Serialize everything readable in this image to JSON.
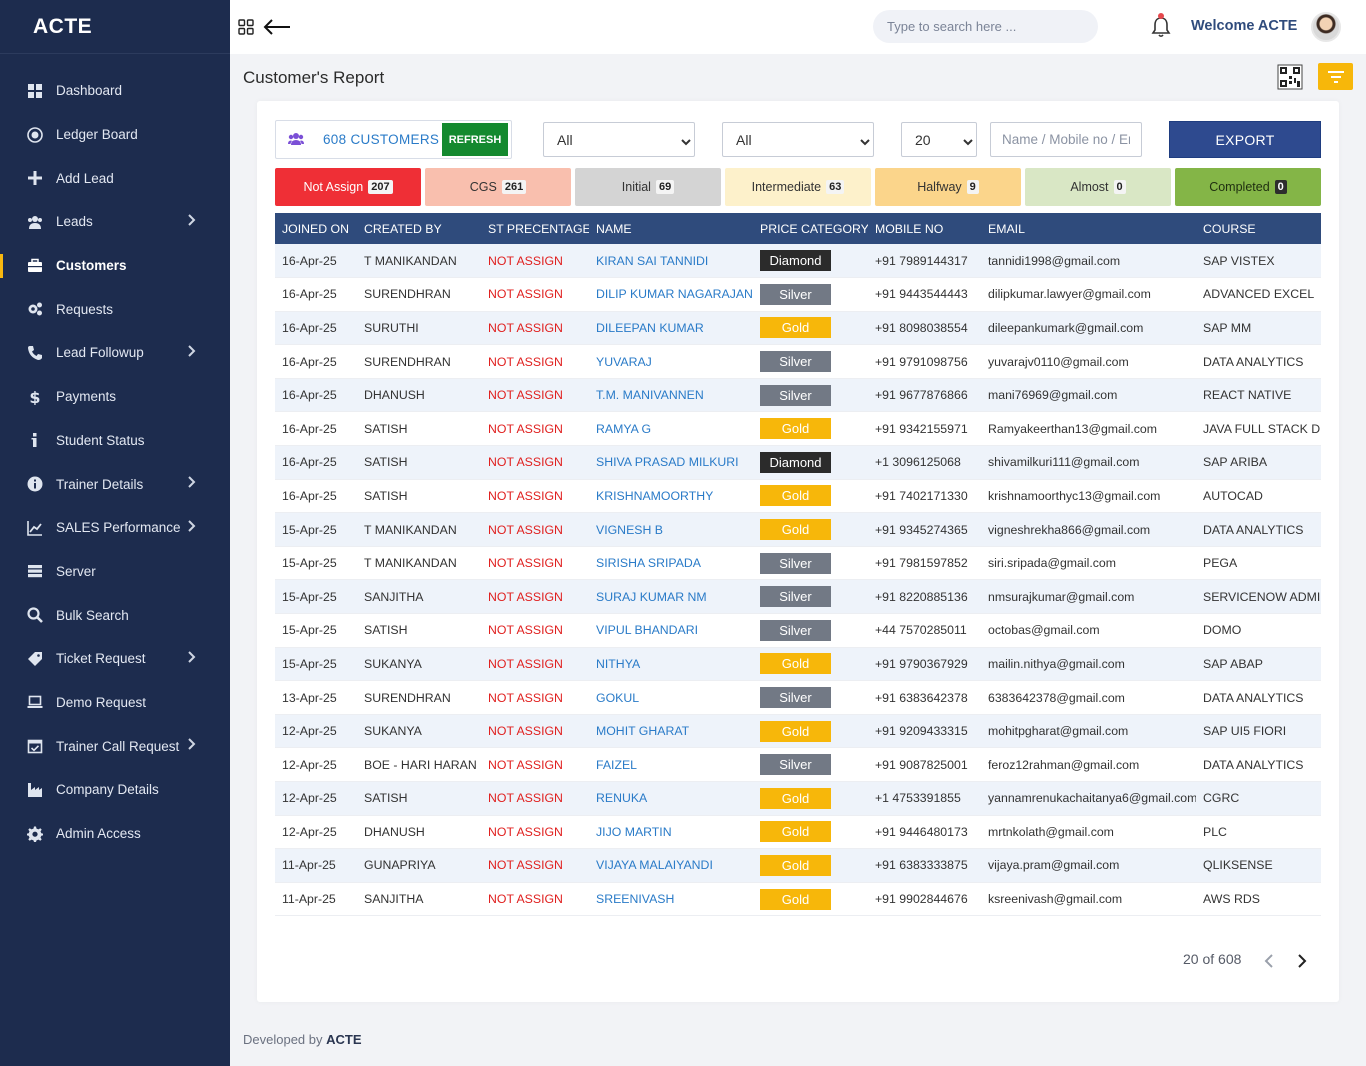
{
  "brand": "ACTE",
  "sidebar": {
    "items": [
      {
        "label": "Dashboard",
        "icon": "dashboard-icon",
        "chevron": false,
        "active": false
      },
      {
        "label": "Ledger Board",
        "icon": "target-icon",
        "chevron": false,
        "active": false
      },
      {
        "label": "Add Lead",
        "icon": "plus-icon",
        "chevron": false,
        "active": false
      },
      {
        "label": "Leads",
        "icon": "users-icon",
        "chevron": true,
        "active": false
      },
      {
        "label": "Customers",
        "icon": "briefcase-icon",
        "chevron": false,
        "active": true
      },
      {
        "label": "Requests",
        "icon": "gears-icon",
        "chevron": false,
        "active": false
      },
      {
        "label": "Lead Followup",
        "icon": "phone-icon",
        "chevron": true,
        "active": false
      },
      {
        "label": "Payments",
        "icon": "dollar-icon",
        "chevron": false,
        "active": false
      },
      {
        "label": "Student Status",
        "icon": "info-icon",
        "chevron": false,
        "active": false
      },
      {
        "label": "Trainer Details",
        "icon": "info-circle-icon",
        "chevron": true,
        "active": false
      },
      {
        "label": "SALES Performance",
        "icon": "chart-line-icon",
        "chevron": true,
        "active": false
      },
      {
        "label": "Server",
        "icon": "server-icon",
        "chevron": false,
        "active": false
      },
      {
        "label": "Bulk Search",
        "icon": "search-icon",
        "chevron": false,
        "active": false
      },
      {
        "label": "Ticket Request",
        "icon": "tag-icon",
        "chevron": true,
        "active": false
      },
      {
        "label": "Demo Request",
        "icon": "laptop-icon",
        "chevron": false,
        "active": false
      },
      {
        "label": "Trainer Call Request",
        "icon": "calendar-check-icon",
        "chevron": true,
        "active": false
      },
      {
        "label": "Company Details",
        "icon": "industry-icon",
        "chevron": false,
        "active": false
      },
      {
        "label": "Admin Access",
        "icon": "gear-icon",
        "chevron": false,
        "active": false
      }
    ]
  },
  "header": {
    "search_placeholder": "Type to search here ...",
    "welcome": "Welcome ACTE"
  },
  "page": {
    "title": "Customer's Report"
  },
  "toolbar": {
    "customers_count": "608 CUSTOMERS",
    "refresh_label": "REFRESH",
    "filter1_value": "All",
    "filter2_value": "All",
    "page_size_value": "20",
    "name_placeholder": "Name / Mobile no / Email",
    "export_label": "EXPORT"
  },
  "statuses": [
    {
      "label": "Not Assign",
      "count": "207",
      "bg": "#ef2f36",
      "fg": "#ffffff",
      "dark_badge": false
    },
    {
      "label": "CGS",
      "count": "261",
      "bg": "#f9bfae",
      "fg": "#333333",
      "dark_badge": false
    },
    {
      "label": "Initial",
      "count": "69",
      "bg": "#d4d4d4",
      "fg": "#333333",
      "dark_badge": false
    },
    {
      "label": "Intermediate",
      "count": "63",
      "bg": "#fdf1cb",
      "fg": "#333333",
      "dark_badge": false
    },
    {
      "label": "Halfway",
      "count": "9",
      "bg": "#fbd58b",
      "fg": "#333333",
      "dark_badge": false
    },
    {
      "label": "Almost",
      "count": "0",
      "bg": "#d9e7c5",
      "fg": "#333333",
      "dark_badge": false
    },
    {
      "label": "Completed",
      "count": "0",
      "bg": "#84b547",
      "fg": "#1f2f10",
      "dark_badge": true
    }
  ],
  "table": {
    "columns": [
      "JOINED ON",
      "CREATED BY",
      "ST PRECENTAGE",
      "NAME",
      "PRICE CATEGORY",
      "MOBILE NO",
      "EMAIL",
      "COURSE"
    ],
    "rows": [
      [
        "16-Apr-25",
        "T MANIKANDAN",
        "NOT ASSIGN",
        "KIRAN SAI TANNIDI",
        "Diamond",
        "+91 7989144317",
        "tannidi1998@gmail.com",
        "SAP VISTEX"
      ],
      [
        "16-Apr-25",
        "SURENDHRAN",
        "NOT ASSIGN",
        "DILIP KUMAR NAGARAJAN",
        "Silver",
        "+91 9443544443",
        "dilipkumar.lawyer@gmail.com",
        "ADVANCED EXCEL"
      ],
      [
        "16-Apr-25",
        "SURUTHI",
        "NOT ASSIGN",
        "DILEEPAN KUMAR",
        "Gold",
        "+91 8098038554",
        "dileepankumark@gmail.com",
        "SAP MM"
      ],
      [
        "16-Apr-25",
        "SURENDHRAN",
        "NOT ASSIGN",
        "YUVARAJ",
        "Silver",
        "+91 9791098756",
        "yuvarajv0110@gmail.com",
        "DATA ANALYTICS"
      ],
      [
        "16-Apr-25",
        "DHANUSH",
        "NOT ASSIGN",
        "T.M. MANIVANNEN",
        "Silver",
        "+91 9677876866",
        "mani76969@gmail.com",
        "REACT NATIVE"
      ],
      [
        "16-Apr-25",
        "SATISH",
        "NOT ASSIGN",
        "RAMYA G",
        "Gold",
        "+91 9342155971",
        "Ramyakeerthan13@gmail.com",
        "JAVA FULL STACK DEV"
      ],
      [
        "16-Apr-25",
        "SATISH",
        "NOT ASSIGN",
        "SHIVA PRASAD MILKURI",
        "Diamond",
        "+1 3096125068",
        "shivamilkuri111@gmail.com",
        "SAP ARIBA"
      ],
      [
        "16-Apr-25",
        "SATISH",
        "NOT ASSIGN",
        "KRISHNAMOORTHY",
        "Gold",
        "+91 7402171330",
        "krishnamoorthyc13@gmail.com",
        "AUTOCAD"
      ],
      [
        "15-Apr-25",
        "T MANIKANDAN",
        "NOT ASSIGN",
        "VIGNESH B",
        "Gold",
        "+91 9345274365",
        "vigneshrekha866@gmail.com",
        "DATA ANALYTICS"
      ],
      [
        "15-Apr-25",
        "T MANIKANDAN",
        "NOT ASSIGN",
        "SIRISHA SRIPADA",
        "Silver",
        "+91 7981597852",
        "siri.sripada@gmail.com",
        "PEGA"
      ],
      [
        "15-Apr-25",
        "SANJITHA",
        "NOT ASSIGN",
        "SURAJ KUMAR NM",
        "Silver",
        "+91 8220885136",
        "nmsurajkumar@gmail.com",
        "SERVICENOW ADMIN"
      ],
      [
        "15-Apr-25",
        "SATISH",
        "NOT ASSIGN",
        "VIPUL BHANDARI",
        "Silver",
        "+44 7570285011",
        "octobas@gmail.com",
        "DOMO"
      ],
      [
        "15-Apr-25",
        "SUKANYA",
        "NOT ASSIGN",
        "NITHYA",
        "Gold",
        "+91 9790367929",
        "mailin.nithya@gmail.com",
        "SAP ABAP"
      ],
      [
        "13-Apr-25",
        "SURENDHRAN",
        "NOT ASSIGN",
        "GOKUL",
        "Silver",
        "+91 6383642378",
        "6383642378@gmail.com",
        "DATA ANALYTICS"
      ],
      [
        "12-Apr-25",
        "SUKANYA",
        "NOT ASSIGN",
        "MOHIT GHARAT",
        "Gold",
        "+91 9209433315",
        "mohitpgharat@gmail.com",
        "SAP UI5 FIORI"
      ],
      [
        "12-Apr-25",
        "BOE - HARI HARAN",
        "NOT ASSIGN",
        "FAIZEL",
        "Silver",
        "+91 9087825001",
        "feroz12rahman@gmail.com",
        "DATA ANALYTICS"
      ],
      [
        "12-Apr-25",
        "SATISH",
        "NOT ASSIGN",
        "RENUKA",
        "Gold",
        "+1 4753391855",
        "yannamrenukachaitanya6@gmail.com",
        "CGRC"
      ],
      [
        "12-Apr-25",
        "DHANUSH",
        "NOT ASSIGN",
        "JIJO MARTIN",
        "Gold",
        "+91 9446480173",
        "mrtnkolath@gmail.com",
        "PLC"
      ],
      [
        "11-Apr-25",
        "GUNAPRIYA",
        "NOT ASSIGN",
        "VIJAYA MALAIYANDI",
        "Gold",
        "+91 6383333875",
        "vijaya.pram@gmail.com",
        "QLIKSENSE"
      ],
      [
        "11-Apr-25",
        "SANJITHA",
        "NOT ASSIGN",
        "SREENIVASH",
        "Gold",
        "+91 9902844676",
        "ksreenivash@gmail.com",
        "AWS RDS"
      ]
    ]
  },
  "pagination": {
    "info": "20 of 608"
  },
  "footer": {
    "prefix": "Developed by",
    "brand": "ACTE"
  }
}
